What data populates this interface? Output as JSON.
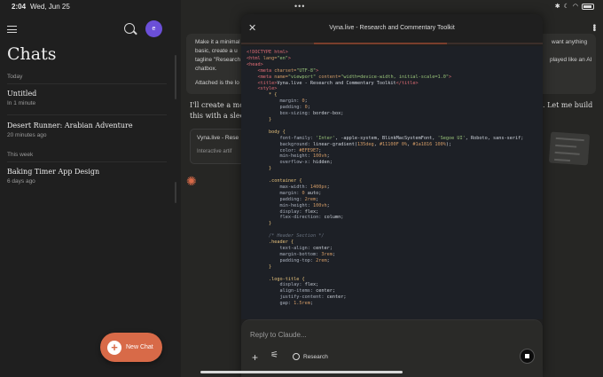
{
  "status_bar": {
    "time": "2:04",
    "date": "Wed, Jun 25",
    "dots": "•••"
  },
  "sidebar": {
    "title": "Chats",
    "avatar_initial": "e",
    "sections": [
      {
        "label": "Today",
        "chats": [
          {
            "title": "Untitled",
            "time": "In 1 minute"
          },
          {
            "title": "Desert Runner: Arabian Adventure",
            "time": "20 minutes ago"
          }
        ]
      },
      {
        "label": "This week",
        "chats": [
          {
            "title": "Baking Timer App Design",
            "time": "6 days ago"
          }
        ]
      }
    ],
    "new_chat_label": "New Chat"
  },
  "conversation": {
    "user_lines": [
      "Make it a minimal",
      "basic, create a u",
      "tagline \"Research",
      "chatbox.",
      "Attached is the lo"
    ],
    "user_right_lines": [
      "want anything",
      "played like an AI"
    ],
    "reply_lines": [
      "I'll create a mod",
      "this with a sleek"
    ],
    "reply_right": ". Let me build",
    "artifact_card_title": "Vyna.live - Rese",
    "artifact_card_subtitle": "Interactive artif"
  },
  "panel": {
    "title": "Vyna.live - Research and Commentary Toolkit",
    "input_placeholder": "Reply to Claude...",
    "research_label": "Research"
  },
  "colors": {
    "accent": "#d86a48",
    "avatar": "#6b4fd8",
    "panel_bg": "#1f1f1f"
  }
}
